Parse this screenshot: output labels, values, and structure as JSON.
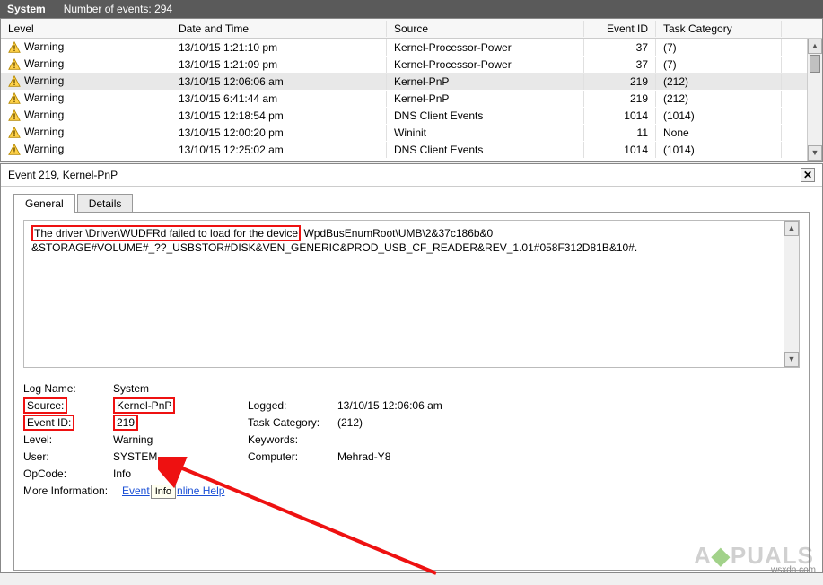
{
  "header": {
    "title": "System",
    "count_label": "Number of events: 294"
  },
  "columns": {
    "level": "Level",
    "date": "Date and Time",
    "source": "Source",
    "event_id": "Event ID",
    "task_cat": "Task Category"
  },
  "rows": [
    {
      "level": "Warning",
      "date": "13/10/15 1:21:10 pm",
      "source": "Kernel-Processor-Power",
      "event_id": "37",
      "task_cat": "(7)",
      "selected": false
    },
    {
      "level": "Warning",
      "date": "13/10/15 1:21:09 pm",
      "source": "Kernel-Processor-Power",
      "event_id": "37",
      "task_cat": "(7)",
      "selected": false
    },
    {
      "level": "Warning",
      "date": "13/10/15 12:06:06 am",
      "source": "Kernel-PnP",
      "event_id": "219",
      "task_cat": "(212)",
      "selected": true
    },
    {
      "level": "Warning",
      "date": "13/10/15 6:41:44 am",
      "source": "Kernel-PnP",
      "event_id": "219",
      "task_cat": "(212)",
      "selected": false
    },
    {
      "level": "Warning",
      "date": "13/10/15 12:18:54 pm",
      "source": "DNS Client Events",
      "event_id": "1014",
      "task_cat": "(1014)",
      "selected": false
    },
    {
      "level": "Warning",
      "date": "13/10/15 12:00:20 pm",
      "source": "Wininit",
      "event_id": "11",
      "task_cat": "None",
      "selected": false
    },
    {
      "level": "Warning",
      "date": "13/10/15 12:25:02 am",
      "source": "DNS Client Events",
      "event_id": "1014",
      "task_cat": "(1014)",
      "selected": false
    }
  ],
  "detail_title": "Event 219, Kernel-PnP",
  "tabs": {
    "general": "General",
    "details": "Details"
  },
  "description": {
    "highlight": "The driver \\Driver\\WUDFRd failed to load for the device",
    "rest_line1": " WpdBusEnumRoot\\UMB\\2&37c186b&0",
    "line2": "&STORAGE#VOLUME#_??_USBSTOR#DISK&VEN_GENERIC&PROD_USB_CF_READER&REV_1.01#058F312D81B&10#."
  },
  "props": {
    "log_name_label": "Log Name:",
    "log_name_val": "System",
    "source_label": "Source:",
    "source_val": "Kernel-PnP",
    "logged_label": "Logged:",
    "logged_val": "13/10/15 12:06:06 am",
    "event_id_label": "Event ID:",
    "event_id_val": "219",
    "task_cat_label": "Task Category:",
    "task_cat_val": "(212)",
    "level_label": "Level:",
    "level_val": "Warning",
    "keywords_label": "Keywords:",
    "keywords_val": "",
    "user_label": "User:",
    "user_val": "SYSTEM",
    "computer_label": "Computer:",
    "computer_val": "Mehrad-Y8",
    "opcode_label": "OpCode:",
    "opcode_val": "Info",
    "more_info_label": "More Information:",
    "help_link_a": "Event",
    "help_link_b": "nline Help",
    "tooltip": "Info"
  },
  "watermark": "A   PUALS",
  "wsxdn": "wsxdn.com"
}
